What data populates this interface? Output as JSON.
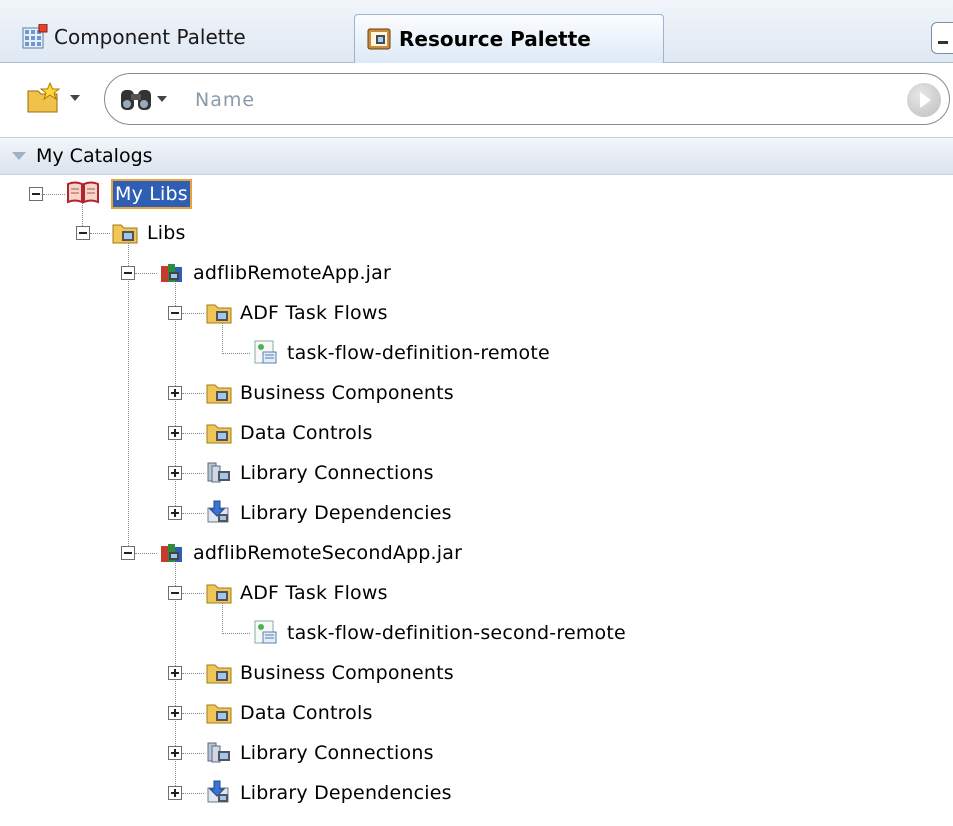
{
  "tabs": [
    {
      "label": "Component Palette",
      "icon": "grid-palette-icon",
      "active": false
    },
    {
      "label": "Resource Palette",
      "icon": "resource-book-icon",
      "active": true
    }
  ],
  "toolbar": {
    "new_icon": "new-folder-star-icon",
    "search_icon": "binoculars-icon",
    "search_placeholder": "Name",
    "go_icon": "play-circle-icon"
  },
  "section": {
    "label": "My Catalogs",
    "expanded": true
  },
  "tree": {
    "root": {
      "label": "My Libs",
      "icon": "book-icon",
      "selected": true
    },
    "libs": {
      "label": "Libs",
      "icon": "folder-icon"
    },
    "jars": [
      {
        "label": "adflibRemoteApp.jar",
        "icon": "jar-icon",
        "children": [
          {
            "label": "ADF Task Flows",
            "icon": "folder-icon",
            "expanded": true,
            "children": [
              {
                "label": "task-flow-definition-remote",
                "icon": "task-flow-icon"
              }
            ]
          },
          {
            "label": "Business Components",
            "icon": "folder-icon",
            "expanded": false
          },
          {
            "label": "Data Controls",
            "icon": "folder-icon",
            "expanded": false
          },
          {
            "label": "Library Connections",
            "icon": "connections-icon",
            "expanded": false
          },
          {
            "label": "Library Dependencies",
            "icon": "dependencies-icon",
            "expanded": false
          }
        ]
      },
      {
        "label": "adflibRemoteSecondApp.jar",
        "icon": "jar-icon",
        "children": [
          {
            "label": "ADF Task Flows",
            "icon": "folder-icon",
            "expanded": true,
            "children": [
              {
                "label": "task-flow-definition-second-remote",
                "icon": "task-flow-icon"
              }
            ]
          },
          {
            "label": "Business Components",
            "icon": "folder-icon",
            "expanded": false
          },
          {
            "label": "Data Controls",
            "icon": "folder-icon",
            "expanded": false
          },
          {
            "label": "Library Connections",
            "icon": "connections-icon",
            "expanded": false
          },
          {
            "label": "Library Dependencies",
            "icon": "dependencies-icon",
            "expanded": false
          }
        ]
      }
    ]
  },
  "colors": {
    "selection": "#2f5fb5",
    "selection_outline": "#e8a23c",
    "header_bg": "#dae3ee"
  }
}
